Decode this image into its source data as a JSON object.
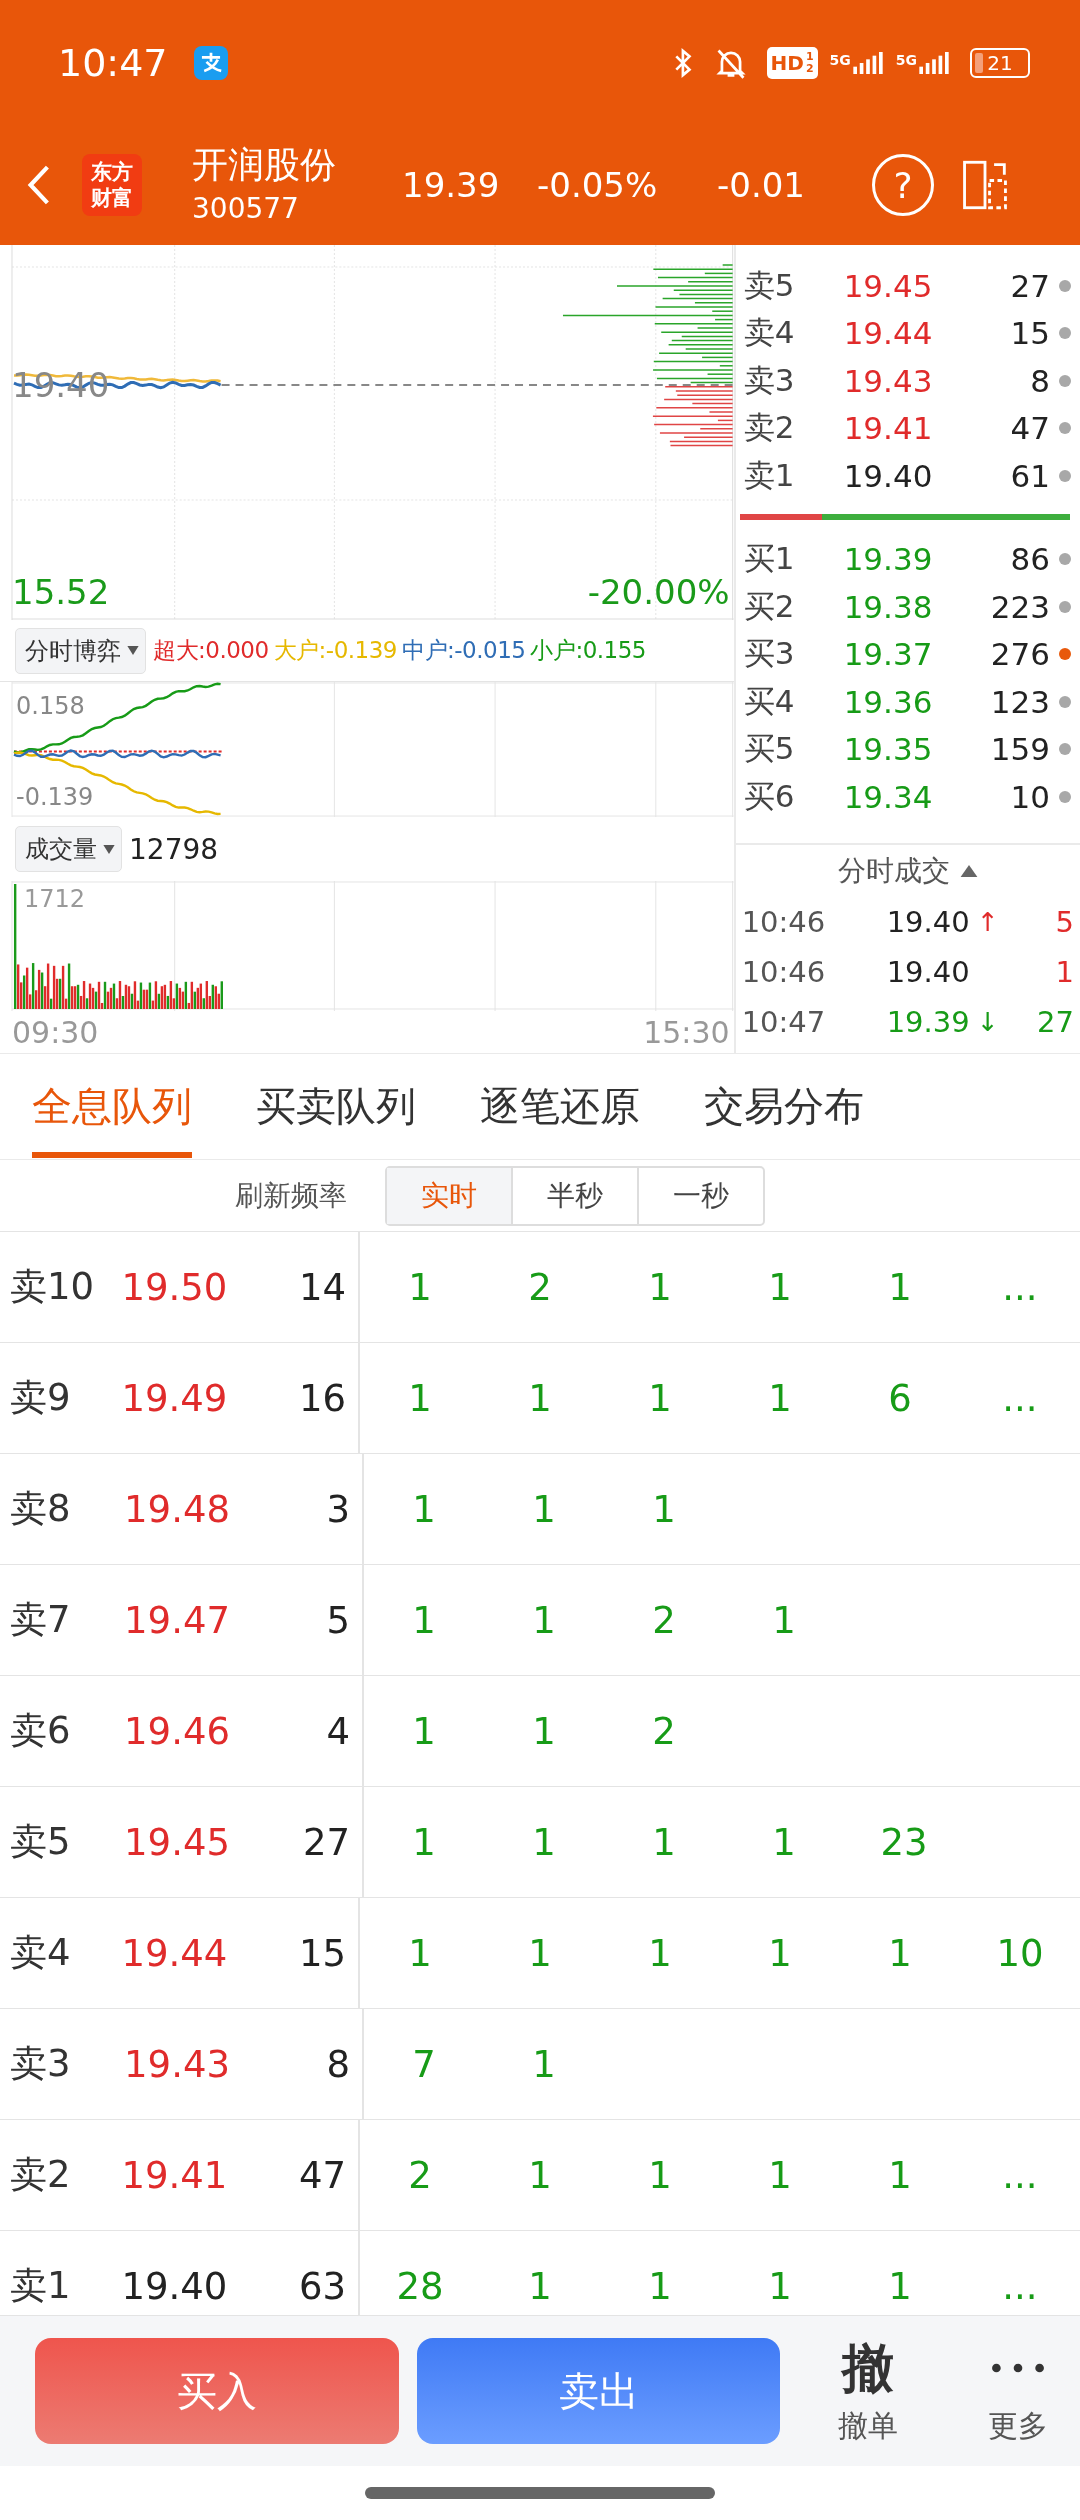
{
  "status_bar": {
    "time": "10:47",
    "hd_badge": "HD",
    "hd_fraction": [
      "1",
      "2"
    ],
    "networks": [
      "5G",
      "5G"
    ],
    "battery": "21"
  },
  "header": {
    "logo_lines": [
      "东方",
      "财富"
    ],
    "name": "开润股份",
    "code": "300577",
    "price": "19.39",
    "change_pct": "-0.05%",
    "change": "-0.01",
    "help": "?"
  },
  "chart": {
    "price_label": "19.40",
    "low_label": "15.52",
    "low_pct": "-20.00%",
    "indicator": {
      "dropdown": "分时博弈",
      "legend": [
        {
          "text": "超大:0.000",
          "color": "#e02b2b"
        },
        {
          "text": "大户:-0.139",
          "color": "#e6b800"
        },
        {
          "text": "中户:-0.015",
          "color": "#2f6db5"
        },
        {
          "text": "小户:0.155",
          "color": "#179b17"
        }
      ],
      "max_label": "0.158",
      "min_label": "-0.139"
    },
    "volume": {
      "dropdown": "成交量",
      "total": "12798",
      "max_label": "1712"
    },
    "time_start": "09:30",
    "time_end": "15:30"
  },
  "order_book": {
    "sells": [
      {
        "label": "卖5",
        "price": "19.45",
        "qty": "27",
        "color": "#e02b2b",
        "marked": false
      },
      {
        "label": "卖4",
        "price": "19.44",
        "qty": "15",
        "color": "#e02b2b",
        "marked": false
      },
      {
        "label": "卖3",
        "price": "19.43",
        "qty": "8",
        "color": "#e02b2b",
        "marked": false
      },
      {
        "label": "卖2",
        "price": "19.41",
        "qty": "47",
        "color": "#e02b2b",
        "marked": false
      },
      {
        "label": "卖1",
        "price": "19.40",
        "qty": "61",
        "color": "#222222",
        "marked": false
      }
    ],
    "ratio_bar": {
      "level": 0.25
    },
    "buys": [
      {
        "label": "买1",
        "price": "19.39",
        "qty": "86",
        "color": "#179b17",
        "marked": false
      },
      {
        "label": "买2",
        "price": "19.38",
        "qty": "223",
        "color": "#179b17",
        "marked": false
      },
      {
        "label": "买3",
        "price": "19.37",
        "qty": "276",
        "color": "#179b17",
        "marked": true
      },
      {
        "label": "买4",
        "price": "19.36",
        "qty": "123",
        "color": "#179b17",
        "marked": false
      },
      {
        "label": "买5",
        "price": "19.35",
        "qty": "159",
        "color": "#179b17",
        "marked": false
      },
      {
        "label": "买6",
        "price": "19.34",
        "qty": "10",
        "color": "#179b17",
        "marked": false
      }
    ]
  },
  "trades": {
    "title": "分时成交",
    "rows": [
      {
        "time": "10:46",
        "price": "19.40",
        "below_close": false,
        "arrow": "↑",
        "qty": "5",
        "color": "#e02b2b"
      },
      {
        "time": "10:46",
        "price": "19.40",
        "below_close": false,
        "qty": "1",
        "color": "#e02b2b"
      },
      {
        "time": "10:47",
        "price": "19.39",
        "below_close": true,
        "arrow": "↓",
        "qty": "27",
        "color": "#179b17"
      }
    ]
  },
  "tabs": [
    {
      "label": "全息队列",
      "selected": true
    },
    {
      "label": "买卖队列",
      "selected": false
    },
    {
      "label": "逐笔还原",
      "selected": false
    },
    {
      "label": "交易分布",
      "selected": false
    }
  ],
  "refresh": {
    "label": "刷新频率",
    "options": [
      {
        "label": "实时",
        "selected": true
      },
      {
        "label": "半秒",
        "selected": false
      },
      {
        "label": "一秒",
        "selected": false
      }
    ]
  },
  "queue": [
    {
      "label": "卖10",
      "price": "19.50",
      "qty": "14",
      "color": "#e02b2b",
      "orders": [
        "1",
        "2",
        "1",
        "1",
        "1",
        "..."
      ]
    },
    {
      "label": "卖9",
      "price": "19.49",
      "qty": "16",
      "color": "#e02b2b",
      "orders": [
        "1",
        "1",
        "1",
        "1",
        "6",
        "..."
      ]
    },
    {
      "label": "卖8",
      "price": "19.48",
      "qty": "3",
      "color": "#e02b2b",
      "orders": [
        "1",
        "1",
        "1"
      ]
    },
    {
      "label": "卖7",
      "price": "19.47",
      "qty": "5",
      "color": "#e02b2b",
      "orders": [
        "1",
        "1",
        "2",
        "1"
      ]
    },
    {
      "label": "卖6",
      "price": "19.46",
      "qty": "4",
      "color": "#e02b2b",
      "orders": [
        "1",
        "1",
        "2"
      ]
    },
    {
      "label": "卖5",
      "price": "19.45",
      "qty": "27",
      "color": "#e02b2b",
      "orders": [
        "1",
        "1",
        "1",
        "1",
        "23"
      ]
    },
    {
      "label": "卖4",
      "price": "19.44",
      "qty": "15",
      "color": "#e02b2b",
      "orders": [
        "1",
        "1",
        "1",
        "1",
        "1",
        "10"
      ]
    },
    {
      "label": "卖3",
      "price": "19.43",
      "qty": "8",
      "color": "#e02b2b",
      "orders": [
        "7",
        "1"
      ]
    },
    {
      "label": "卖2",
      "price": "19.41",
      "qty": "47",
      "color": "#e02b2b",
      "orders": [
        "2",
        "1",
        "1",
        "1",
        "1",
        "..."
      ]
    },
    {
      "label": "卖1",
      "price": "19.40",
      "qty": "63",
      "color": "#222222",
      "orders": [
        "28",
        "1",
        "1",
        "1",
        "1",
        "..."
      ]
    }
  ],
  "bottom_bar": {
    "buy": "买入",
    "sell": "卖出",
    "cancel_glyph": "撤",
    "cancel": "撤单",
    "more": "更多"
  }
}
